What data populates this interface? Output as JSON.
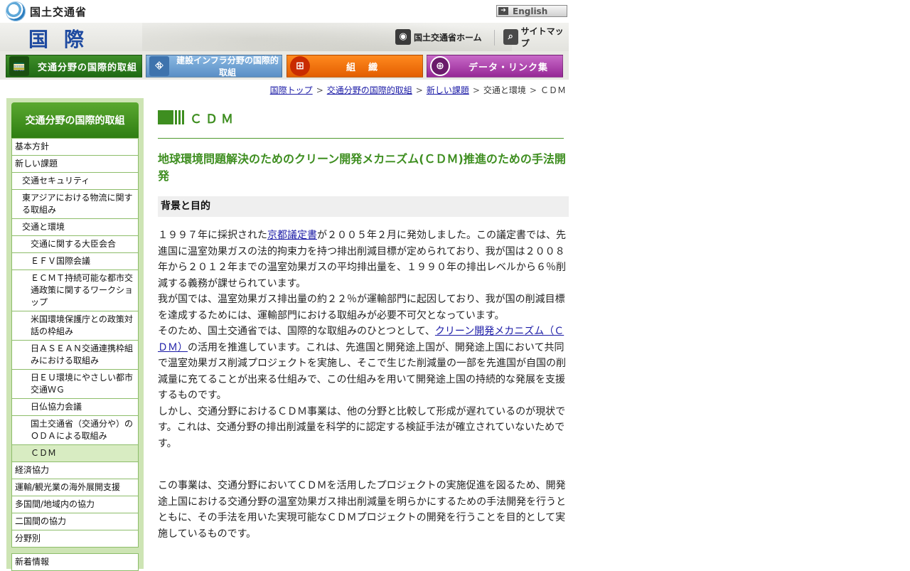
{
  "header": {
    "logo_text": "国土交通省",
    "english_label": "English",
    "section_title": "国際",
    "home_link": "国土交通省ホーム",
    "sitemap_link": "サイトマップ"
  },
  "tabs": [
    {
      "label": "交通分野の国際的取組"
    },
    {
      "label": "建設インフラ分野の国際的取組"
    },
    {
      "label": "組織"
    },
    {
      "label": "データ・リンク集"
    }
  ],
  "breadcrumb": {
    "items": [
      "国際トップ",
      "交通分野の国際的取組",
      "新しい課題"
    ],
    "current_parent": "交通と環境",
    "current": "ＣＤＭ",
    "separator": ">"
  },
  "sidebar": {
    "heading": "交通分野の国際的取組",
    "items": [
      {
        "label": "基本方針"
      },
      {
        "label": "新しい課題"
      },
      {
        "label": "交通セキュリティ"
      },
      {
        "label": "東アジアにおける物流に関する取組み"
      },
      {
        "label": "交通と環境"
      },
      {
        "label": "交通に関する大臣会合"
      },
      {
        "label": "ＥＦＶ国際会議"
      },
      {
        "label": "ＥＣＭＴ持続可能な都市交通政策に関するワークショップ"
      },
      {
        "label": "米国環境保護庁との政策対話の枠組み"
      },
      {
        "label": "日ＡＳＥＡＮ交通連携枠組みにおける取組み"
      },
      {
        "label": "日ＥＵ環境にやさしい都市交通ＷＧ"
      },
      {
        "label": "日仏協力会議"
      },
      {
        "label": "国土交通省（交通分や）のＯＤＡによる取組み"
      },
      {
        "label": "ＣＤＭ"
      },
      {
        "label": "経済協力"
      },
      {
        "label": "運輸/観光業の海外展開支援"
      },
      {
        "label": "多国間/地域内の協力"
      },
      {
        "label": "二国間の協力"
      },
      {
        "label": "分野別"
      }
    ],
    "news": "新着情報"
  },
  "content": {
    "title": "ＣＤＭ",
    "subtitle": "地球環境問題解決のためのクリーン開発メカニズム(ＣＤＭ)推進のための手法開発",
    "section_heading": "背景と目的",
    "p1_a": "１９９７年に採択された",
    "p1_link": "京都議定書",
    "p1_b": "が２００５年２月に発効しました。この議定書では、先進国に温室効果ガスの法的拘束力を持つ排出削減目標が定められており、我が国は２００８年から２０１２年までの温室効果ガスの平均排出量を、１９９０年の排出レベルから６％削減する義務が課せられています。",
    "p1_c": "我が国では、温室効果ガス排出量の約２２％が運輸部門に起因しており、我が国の削減目標を達成するためには、運輸部門における取組みが必要不可欠となっています。",
    "p1_d": "そのため、国土交通省では、国際的な取組みのひとつとして、",
    "p1_link2": "クリーン開発メカニズム（ＣＤＭ）",
    "p1_e": "の活用を推進しています。これは、先進国と開発途上国が、開発途上国において共同で温室効果ガス削減プロジェクトを実施し、そこで生じた削減量の一部を先進国が自国の削減量に充てることが出来る仕組みで、この仕組みを用いて開発途上国の持続的な発展を支援するものです。",
    "p1_f": "しかし、交通分野におけるＣＤＭ事業は、他の分野と比較して形成が遅れているのが現状です。これは、交通分野の排出削減量を科学的に認定する検証手法が確立されていないためです。",
    "p2": "この事業は、交通分野においてＣＤＭを活用したプロジェクトの実施促進を図るため、開発途上国における交通分野の温室効果ガス排出削減量を明らかにするための手法開発を行うとともに、その手法を用いた実現可能なＣＤＭプロジェクトの開発を行うことを目的として実施しているものです。"
  }
}
